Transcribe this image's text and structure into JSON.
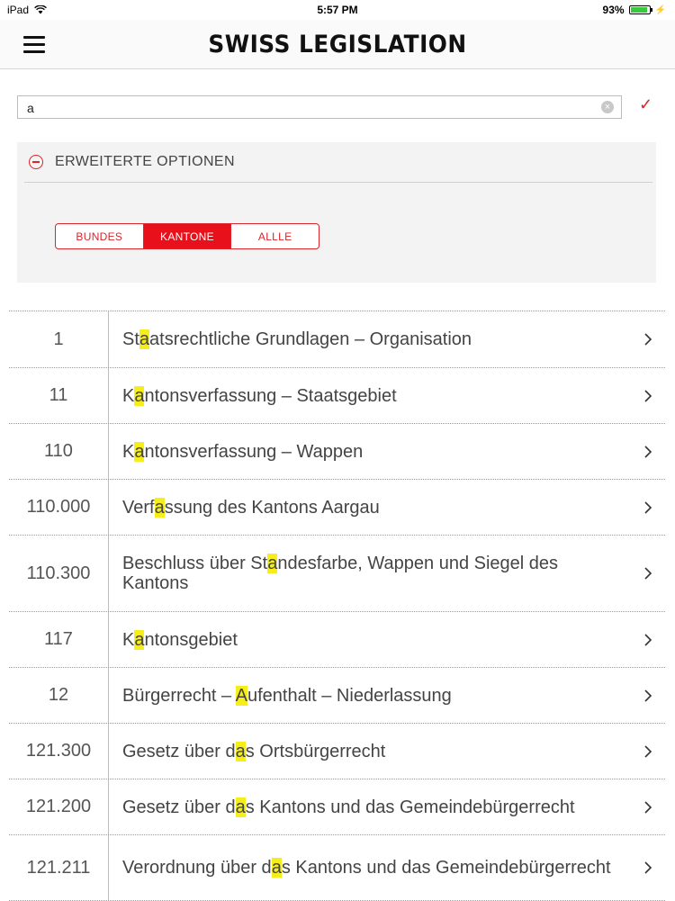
{
  "status_bar": {
    "device": "iPad",
    "time": "5:57 PM",
    "battery": "93%",
    "battery_level": 0.93
  },
  "header": {
    "title": "SWISS LEGISLATION"
  },
  "search": {
    "value": "a"
  },
  "advanced": {
    "label": "ERWEITERTE OPTIONEN",
    "segments": [
      {
        "label": "BUNDES",
        "active": false
      },
      {
        "label": "KANTONE",
        "active": true
      },
      {
        "label": "ALLLE",
        "active": false
      }
    ]
  },
  "colors": {
    "accent": "#e8101a",
    "highlight": "#f6ee1a"
  },
  "results": [
    {
      "number": "1",
      "before": "St",
      "hl": "a",
      "after": "atsrechtliche Grundlagen – Organisation"
    },
    {
      "number": "11",
      "before": "K",
      "hl": "a",
      "after": "ntonsverfassung – Staatsgebiet"
    },
    {
      "number": "110",
      "before": "K",
      "hl": "a",
      "after": "ntonsverfassung – Wappen"
    },
    {
      "number": "110.000",
      "before": "Verf",
      "hl": "a",
      "after": "ssung des Kantons Aargau"
    },
    {
      "number": "110.300",
      "before": "Beschluss über St",
      "hl": "a",
      "after": "ndesfarbe, Wappen und Siegel des Kantons"
    },
    {
      "number": "117",
      "before": "K",
      "hl": "a",
      "after": "ntonsgebiet"
    },
    {
      "number": "12",
      "before": "Bürgerrecht – ",
      "hl": "A",
      "after": "ufenthalt – Niederlassung"
    },
    {
      "number": "121.300",
      "before": "Gesetz über d",
      "hl": "a",
      "after": "s Ortsbürgerrecht"
    },
    {
      "number": "121.200",
      "before": "Gesetz über d",
      "hl": "a",
      "after": "s Kantons  und das Gemeindebürgerrecht"
    },
    {
      "number": "121.211",
      "before": "Verordnung über d",
      "hl": "a",
      "after": "s Kantons  und das Gemeindebürgerrecht"
    }
  ]
}
